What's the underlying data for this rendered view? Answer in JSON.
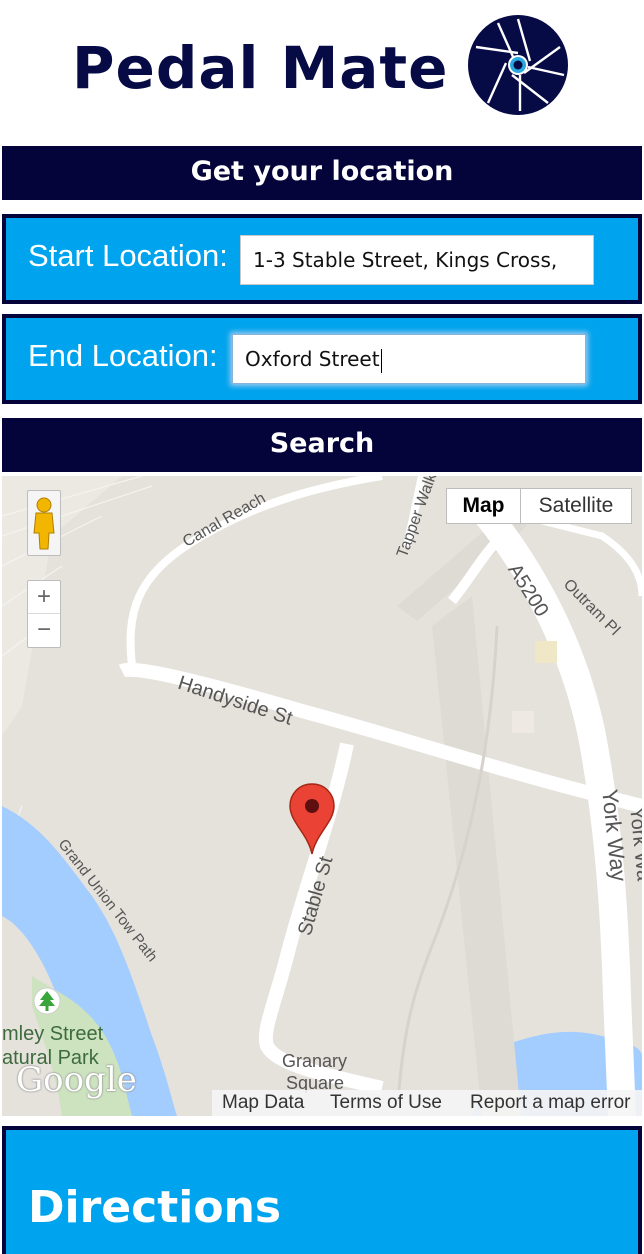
{
  "header": {
    "app_title": "Pedal Mate",
    "logo_icon": "camera-aperture-icon",
    "brand_color": "#060a45"
  },
  "get_location": {
    "label": "Get your location"
  },
  "start_location": {
    "label": "Start Location:",
    "value": "1-3 Stable Street, Kings Cross,"
  },
  "end_location": {
    "label": "End Location:",
    "value": "Oxford Street"
  },
  "search": {
    "label": "Search"
  },
  "map": {
    "type_buttons": {
      "map": "Map",
      "satellite": "Satellite"
    },
    "zoom_in": "+",
    "zoom_out": "−",
    "streets": {
      "canal_reach": "Canal Reach",
      "tapper_walk": "Tapper Walk",
      "a5200": "A5200",
      "outram_pl": "Outram Pl",
      "handyside_st": "Handyside St",
      "stable_st": "Stable St",
      "york_way": "York Way",
      "york_way_2": "York Wa",
      "grand_union": "Grand Union Tow Path",
      "camley_1": "mley Street",
      "camley_2": "atural Park",
      "granary_1": "Granary",
      "granary_2": "Square"
    },
    "brand": "Google",
    "footer": {
      "map_data": "Map Data",
      "terms": "Terms of Use",
      "report": "Report a map error"
    },
    "marker_icon": "map-pin-icon",
    "pegman_icon": "pegman-icon",
    "park_icon": "tree-icon"
  },
  "directions": {
    "title": "Directions"
  },
  "colors": {
    "navy": "#04043a",
    "panel_blue": "#00a3ed",
    "map_land": "#e5e2dc",
    "water": "#a3ccff"
  }
}
